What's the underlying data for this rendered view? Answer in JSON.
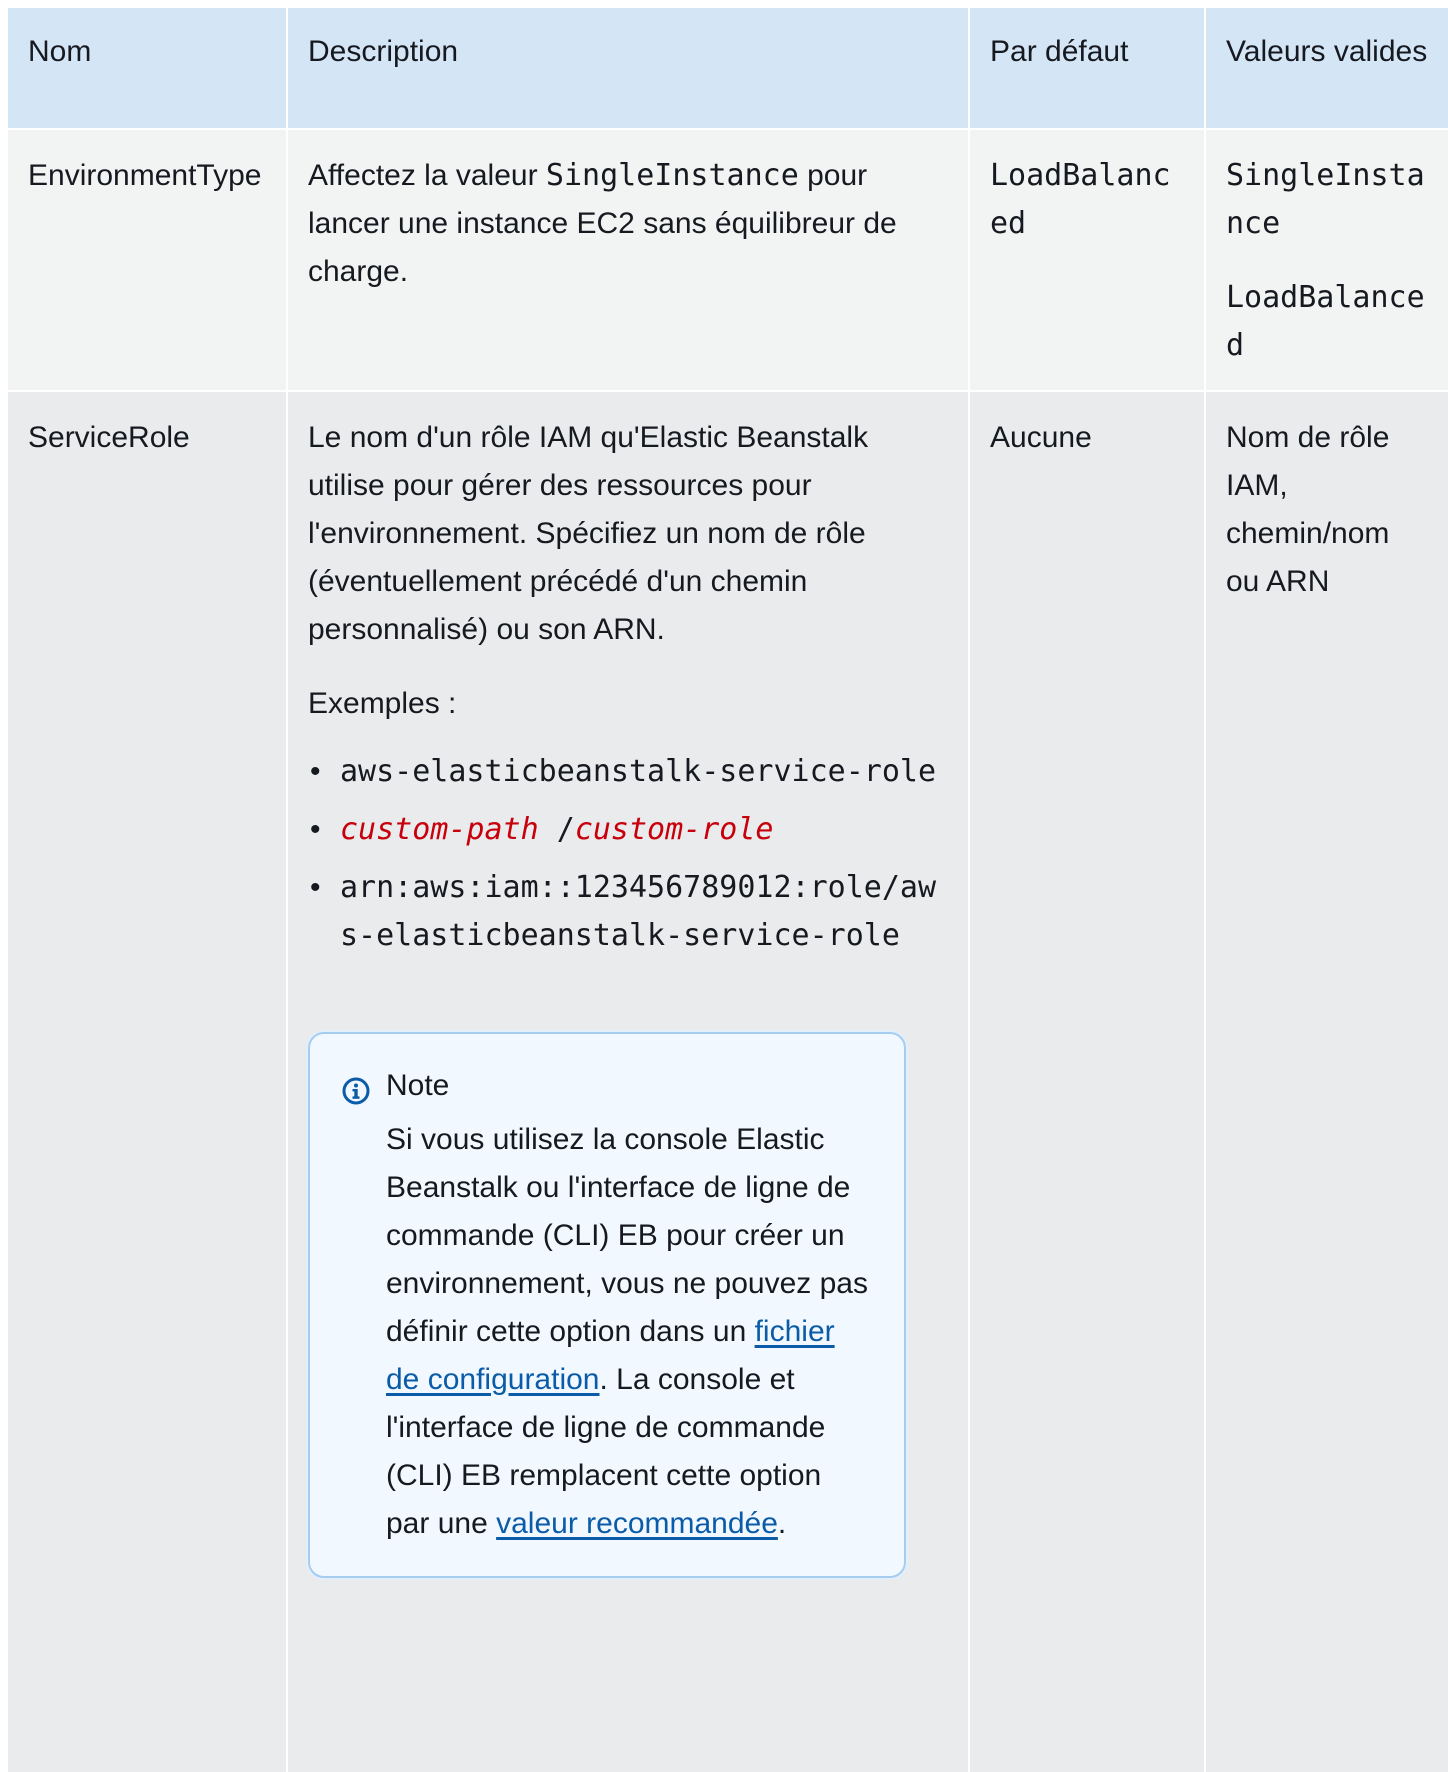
{
  "table": {
    "headers": [
      "Nom",
      "Description",
      "Par défaut",
      "Valeurs valides"
    ],
    "row1": {
      "name": "EnvironmentType",
      "desc_pre": "Affectez la valeur ",
      "desc_code": "SingleInstance",
      "desc_post": " pour lancer une instance EC2 sans équilibreur de charge.",
      "default": "LoadBalanced",
      "valid": [
        "SingleInstance",
        "LoadBalanced"
      ]
    },
    "row2": {
      "name": "ServiceRole",
      "desc": "Le nom d'un rôle IAM qu'Elastic Beanstalk utilise pour gérer des ressources pour l'environnement. Spécifiez un nom de rôle (éventuellement précédé d'un chemin personnalisé) ou son ARN.",
      "examples_label": "Exemples :",
      "example1": "aws-elasticbeanstalk-service-role",
      "example2_a": "custom-path",
      "example2_sep": " /",
      "example2_b": "custom-role",
      "example3": "arn:aws:iam::123456789012:role/aws-elasticbeanstalk-service-role",
      "default": "Aucune",
      "valid": "Nom de rôle IAM, chemin/nom ou ARN",
      "note": {
        "title": "Note",
        "text_1": "Si vous utilisez la console Elastic Beanstalk ou l'interface de ligne de commande (CLI) EB pour créer un environnement, vous ne pouvez pas définir cette option dans un ",
        "link_1": "fichier de configuration",
        "text_2": ". La console et l'interface de ligne de commande (CLI) EB remplacent cette option par une ",
        "link_2": "valeur recommandée",
        "text_3": "."
      }
    }
  },
  "colors": {
    "header_bg": "#d4e5f6",
    "row_bg": "#f2f3f3",
    "note_bg": "#f1f8ff",
    "note_border": "#a6cdf0",
    "link": "#0b5ca8",
    "replaceable": "#c7000b"
  },
  "icons": {
    "note": "info-circle-icon"
  }
}
